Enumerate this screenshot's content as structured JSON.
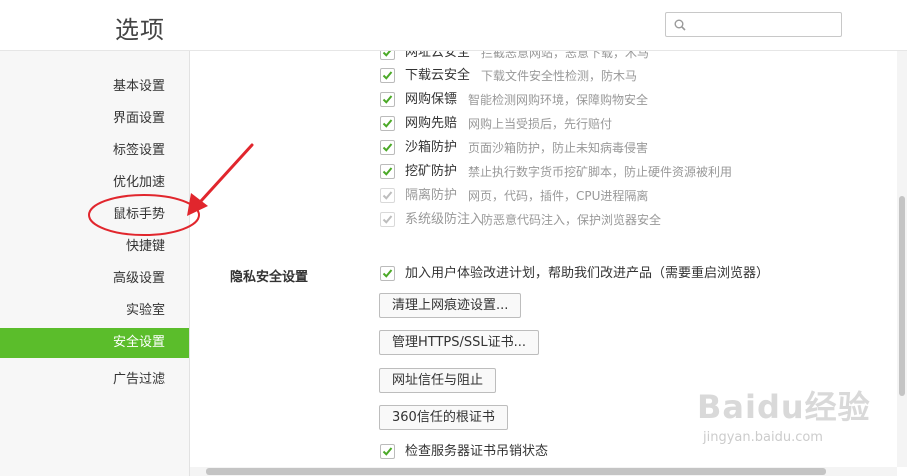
{
  "header": {
    "title": "选项",
    "search_placeholder": ""
  },
  "sidebar": {
    "items": [
      {
        "label": "基本设置"
      },
      {
        "label": "界面设置"
      },
      {
        "label": "标签设置"
      },
      {
        "label": "优化加速"
      },
      {
        "label": "鼠标手势"
      },
      {
        "label": "快捷键"
      },
      {
        "label": "高级设置"
      },
      {
        "label": "实验室"
      },
      {
        "label": "安全设置",
        "active": true
      },
      {
        "label": "广告过滤"
      }
    ]
  },
  "security_options": [
    {
      "label": "网址云安全",
      "desc": "拦截恶意网站，恶意下载，木马",
      "checked": true
    },
    {
      "label": "下载云安全",
      "desc": "下载文件安全性检测，防木马",
      "checked": true
    },
    {
      "label": "网购保镖",
      "desc": "智能检测网购环境，保障购物安全",
      "checked": true
    },
    {
      "label": "网购先赔",
      "desc": "网购上当受损后，先行赔付",
      "checked": true
    },
    {
      "label": "沙箱防护",
      "desc": "页面沙箱防护，防止未知病毒侵害",
      "checked": true
    },
    {
      "label": "挖矿防护",
      "desc": "禁止执行数字货币挖矿脚本，防止硬件资源被利用",
      "checked": true
    },
    {
      "label": "隔离防护",
      "desc": "网页，代码，插件，CPU进程隔离",
      "checked": true,
      "disabled": true
    },
    {
      "label": "系统级防注入",
      "desc": "防恶意代码注入，保护浏览器安全",
      "checked": true,
      "disabled": true
    }
  ],
  "privacy": {
    "title": "隐私安全设置",
    "ux_plan_label": "加入用户体验改进计划，帮助我们改进产品（需要重启浏览器）",
    "ux_plan_checked": true,
    "buttons": {
      "clear_traces": "清理上网痕迹设置...",
      "manage_certs": "管理HTTPS/SSL证书...",
      "site_trust": "网址信任与阻止",
      "root_certs": "360信任的根证书"
    },
    "check_revocation_label": "检查服务器证书吊销状态",
    "check_revocation_checked": true
  },
  "watermark": {
    "main": "Baidu经验",
    "sub": "jingyan.baidu.com"
  },
  "colors": {
    "accent": "#5bbd2b",
    "annotation": "#e1262d",
    "check": "#4ba927"
  },
  "icons": {
    "search": "search-icon",
    "check": "check-icon",
    "arrow": "arrow-annotation"
  }
}
